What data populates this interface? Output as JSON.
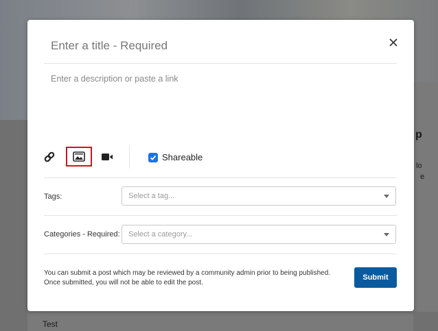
{
  "modal": {
    "title_placeholder": "Enter a title - Required",
    "description_placeholder": "Enter a description or paste a link",
    "toolbar": {
      "icons": [
        "link-icon",
        "image-icon",
        "video-icon"
      ],
      "shareable_label": "Shareable",
      "shareable_checked": true
    },
    "tags": {
      "label": "Tags:",
      "placeholder": "Select a tag..."
    },
    "categories": {
      "label": "Categories - Required:",
      "placeholder": "Select a category..."
    },
    "note": "You can submit a post which may be reviewed by a community admin prior to being published. Once submitted, you will not be able to edit the post.",
    "submit_label": "Submit"
  },
  "background": {
    "fragments": [
      "p",
      "lo",
      "e",
      "Test"
    ]
  },
  "colors": {
    "accent": "#1b73e8",
    "submit": "#0a5b9d",
    "highlight_border": "#c8161d"
  }
}
